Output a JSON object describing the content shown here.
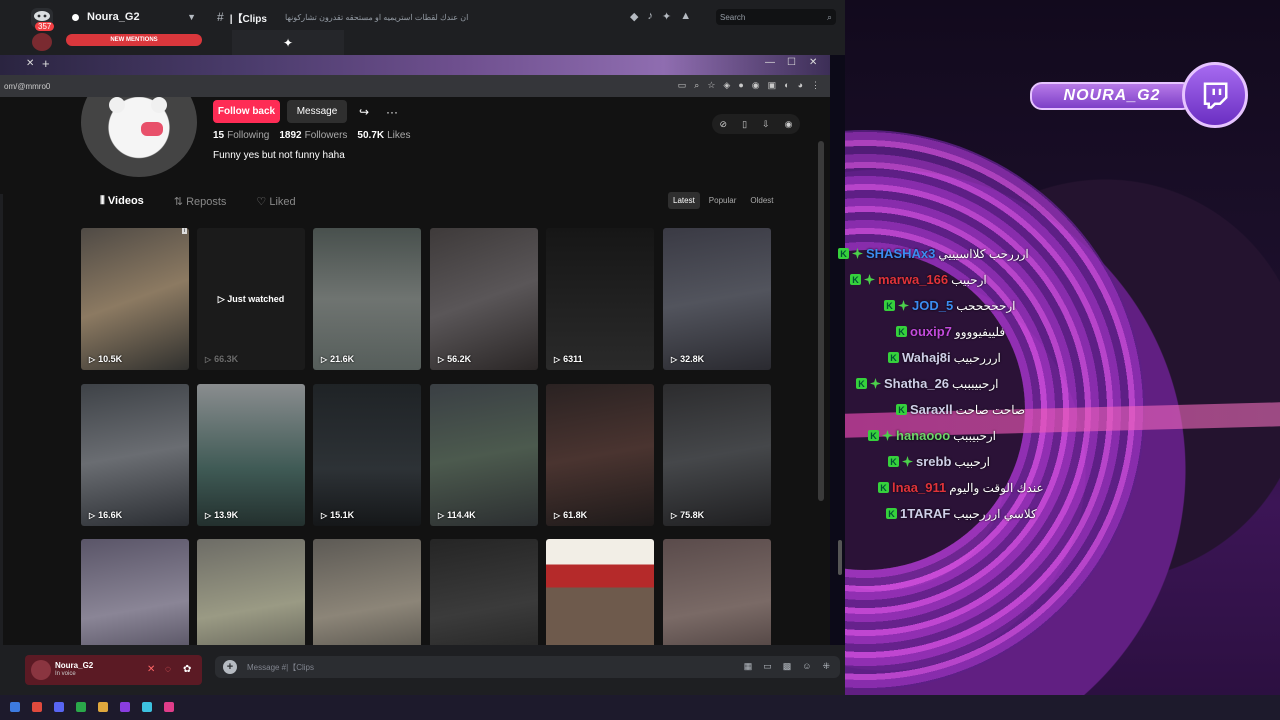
{
  "discord": {
    "badge_count": "357",
    "server_name": "Noura_G2",
    "mentions_label": "NEW MENTIONS",
    "channel_name": "|【Clips",
    "channel_topic": "ان عندك لقطات استريميه او مستحقه تقدرون تشاركونها",
    "search_placeholder": "Search",
    "user_name": "Noura_G2",
    "user_status": "In voice",
    "message_placeholder": "Message #|【Clips"
  },
  "browser": {
    "url": "om/@mmro0"
  },
  "profile": {
    "follow_back": "Follow back",
    "message": "Message",
    "following_count": "15",
    "following_label": "Following",
    "followers_count": "1892",
    "followers_label": "Followers",
    "likes_count": "50.7K",
    "likes_label": "Likes",
    "bio": "Funny yes but not funny haha",
    "tabs": [
      "Videos",
      "Reposts",
      "Liked"
    ],
    "sort": [
      "Latest",
      "Popular",
      "Oldest"
    ]
  },
  "videos": [
    {
      "views": "10.5K",
      "ad": "i"
    },
    {
      "views": "66.3K",
      "overlay": "Just watched"
    },
    {
      "views": "21.6K"
    },
    {
      "views": "56.2K"
    },
    {
      "views": "6311"
    },
    {
      "views": "32.8K"
    },
    {
      "views": "16.6K"
    },
    {
      "views": "13.9K"
    },
    {
      "views": "15.1K"
    },
    {
      "views": "114.4K"
    },
    {
      "views": "61.8K"
    },
    {
      "views": "75.8K"
    },
    {
      "views": ""
    },
    {
      "views": ""
    },
    {
      "views": ""
    },
    {
      "views": ""
    },
    {
      "views": ""
    },
    {
      "views": ""
    }
  ],
  "overlay": {
    "brand": "NOURA_G2",
    "chat": [
      {
        "name": "SHASHAx3",
        "color": "#3c8cf0",
        "msg": "ارررحب كلااسيييي"
      },
      {
        "name": "marwa_166",
        "color": "#e0333a",
        "msg": "ارحبيب"
      },
      {
        "name": "JOD_5",
        "color": "#3c8cf0",
        "msg": "ارحححححب"
      },
      {
        "name": "ouxip7",
        "color": "#c34bdc",
        "msg": "فلييفيوووو"
      },
      {
        "name": "Wahaj8i",
        "color": "#cfcfe8",
        "msg": "ارررحبيب"
      },
      {
        "name": "Shatha_26",
        "color": "#cfcfe8",
        "msg": "ارحبيبببب"
      },
      {
        "name": "Saraxll",
        "color": "#cfcfe8",
        "msg": "صاحت صاحت"
      },
      {
        "name": "hanaooo",
        "color": "#6ed86a",
        "msg": "ارحبيببب"
      },
      {
        "name": "srebb",
        "color": "#cfcfe8",
        "msg": "ارحبيب"
      },
      {
        "name": "lnaa_911",
        "color": "#e0333a",
        "msg": "عندك الوقت واليوم"
      },
      {
        "name": "1TARAF",
        "color": "#cfcfe8",
        "msg": "كلاسي ارررحبيب"
      }
    ]
  },
  "colors": {
    "accent_red": "#fe2c55",
    "discord_bg": "#1e1f22",
    "page_bg": "#121212"
  }
}
